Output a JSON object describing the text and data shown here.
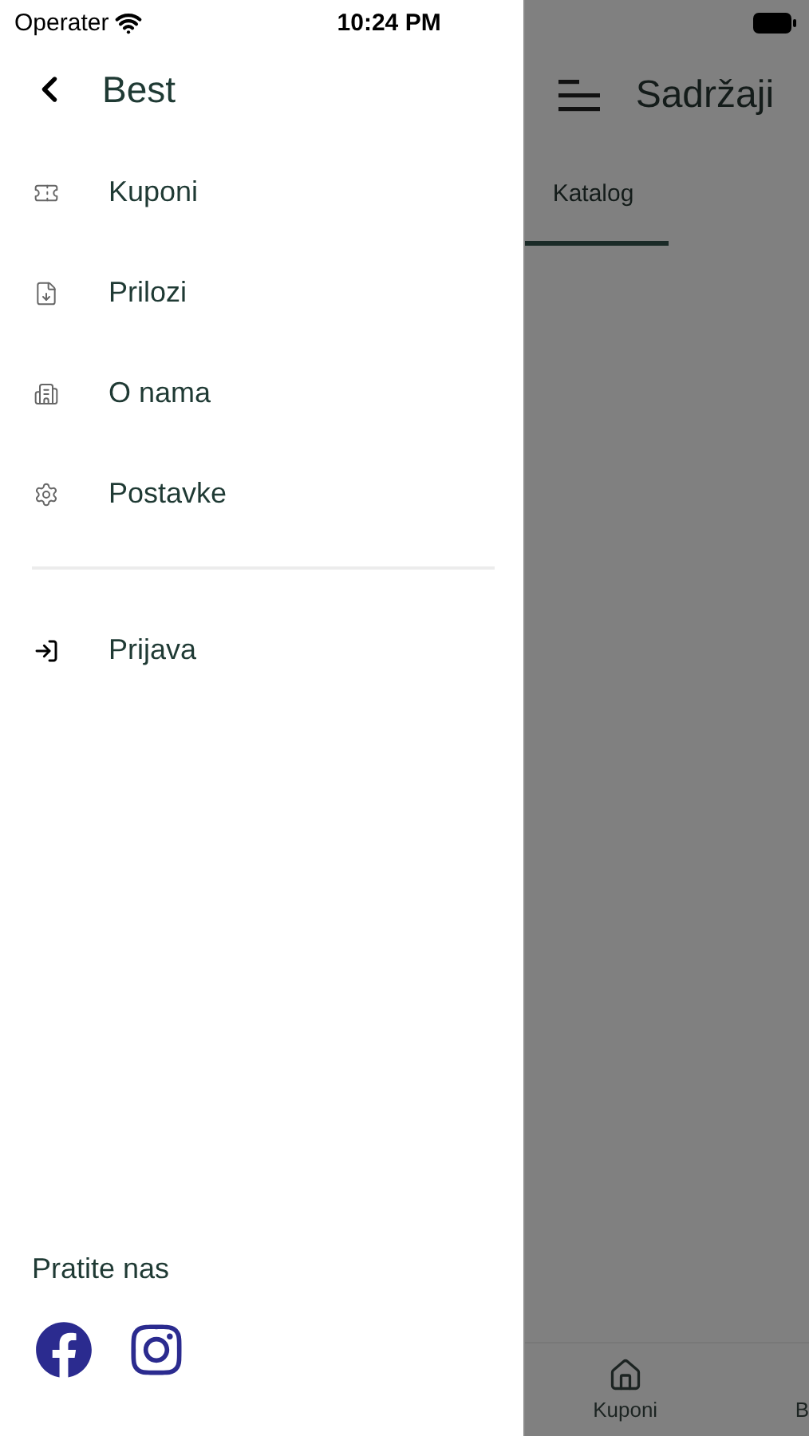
{
  "status_bar": {
    "carrier": "Operater",
    "time": "10:24 PM"
  },
  "drawer": {
    "title": "Best",
    "items": [
      {
        "label": "Kuponi",
        "kind": "ticket"
      },
      {
        "label": "Prilozi",
        "kind": "file"
      },
      {
        "label": "O nama",
        "kind": "building"
      },
      {
        "label": "Postavke",
        "kind": "settings"
      }
    ],
    "secondary_items": [
      {
        "label": "Prijava",
        "kind": "login"
      }
    ],
    "follow_label": "Pratite nas",
    "social": [
      {
        "kind": "facebook"
      },
      {
        "kind": "instagram"
      }
    ]
  },
  "page": {
    "title": "Sadržaji",
    "tabs": [
      {
        "label": "Katalog",
        "selected": true
      }
    ],
    "bottom_tabs": [
      {
        "label": "Kuponi",
        "kind": "home"
      },
      {
        "label": "B",
        "kind": "other"
      }
    ]
  }
}
